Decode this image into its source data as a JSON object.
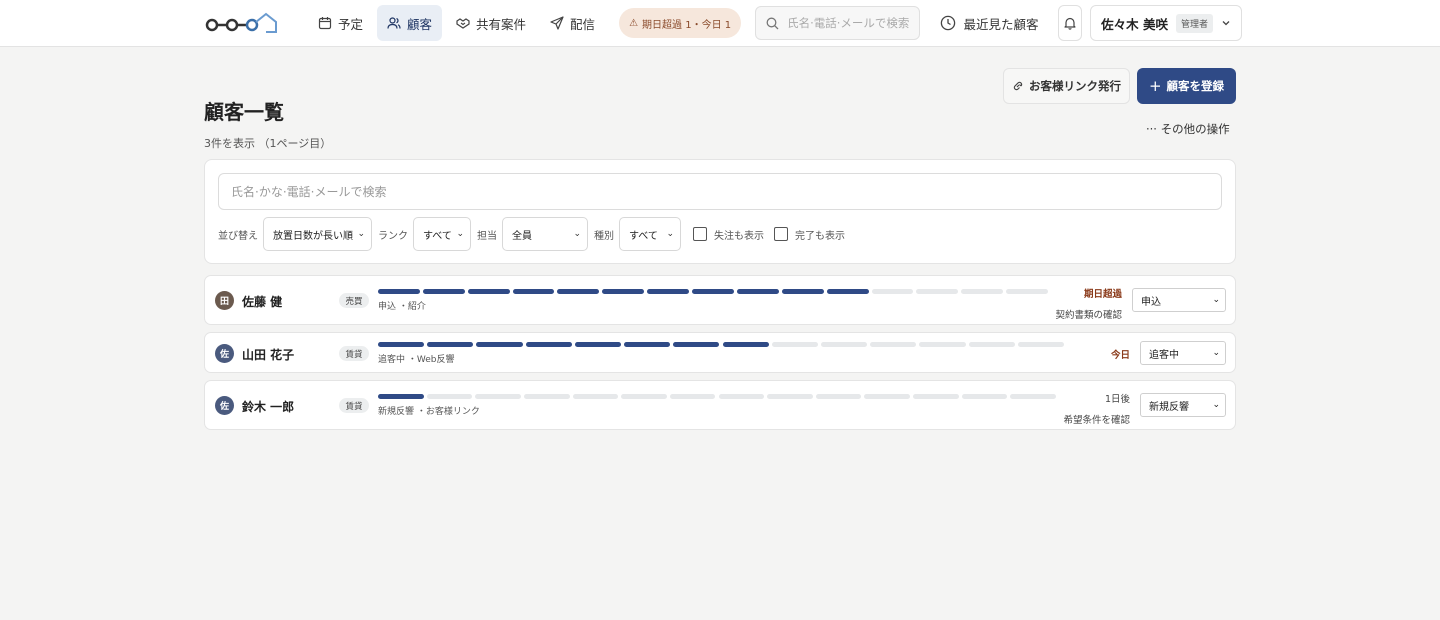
{
  "header": {
    "nav": [
      {
        "label": "予定",
        "icon": "calendar-icon"
      },
      {
        "label": "顧客",
        "icon": "users-icon"
      },
      {
        "label": "共有案件",
        "icon": "handshake-icon"
      },
      {
        "label": "配信",
        "icon": "send-icon"
      }
    ],
    "alert": {
      "icon": "warning-icon",
      "label": "期日超過 1・今日 1"
    },
    "search_placeholder": "氏名·電話·メールで検索",
    "recent_label": "最近見た顧客",
    "user_name": "佐々木 美咲",
    "user_role": "管理者"
  },
  "page": {
    "title": "顧客一覧",
    "subtitle": "3件を表示 （1ページ目）",
    "link_button": "お客様リンク発行",
    "primary_button": "顧客を登録",
    "more_ops": "··· その他の操作"
  },
  "filters": {
    "search_placeholder": "氏名·かな·電話·メールで検索",
    "sort_label": "並び替え",
    "sort_value": "放置日数が長い順",
    "rank_label": "ランク",
    "rank_value": "すべて",
    "owner_label": "担当",
    "owner_value": "全員",
    "kind_label": "種別",
    "kind_value": "すべて",
    "lost_label": "失注も表示",
    "done_label": "完了も表示"
  },
  "colors": {
    "accent": "#2f4a86",
    "progress_done": "#2f4a86",
    "progress_todo": "#e6e8ea",
    "overdue": "#8a3a1a",
    "today": "#8a3a1a"
  },
  "customers": [
    {
      "initial": "田",
      "avatar_color": "#6b5a4e",
      "name": "佐藤 健",
      "type": "売買",
      "progress": {
        "done": 11,
        "total": 15
      },
      "tags": "申込 ・紹介",
      "status": "期日超過",
      "status_color": "#8a3a1a",
      "task": "契約書類の確認",
      "stage": "申込"
    },
    {
      "initial": "佐",
      "avatar_color": "#4a5a7e",
      "name": "山田 花子",
      "type": "賃貸",
      "progress": {
        "done": 8,
        "total": 14
      },
      "tags": "追客中 ・Web反響",
      "status": "今日",
      "status_color": "#8a3a1a",
      "task": "",
      "stage": "追客中"
    },
    {
      "initial": "佐",
      "avatar_color": "#4a5a7e",
      "name": "鈴木 一郎",
      "type": "賃貸",
      "progress": {
        "done": 1,
        "total": 14
      },
      "tags": "新規反響 ・お客様リンク",
      "status": "1日後",
      "status_color": "#444444",
      "task": "希望条件を確認",
      "stage": "新規反響"
    }
  ]
}
